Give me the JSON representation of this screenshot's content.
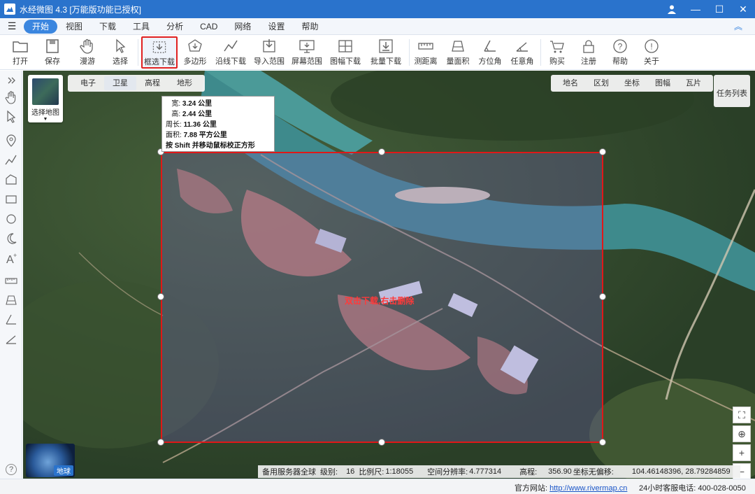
{
  "window": {
    "title": "水经微图 4.3 [万能版功能已授权]"
  },
  "menu": {
    "tabs": [
      "开始",
      "视图",
      "下载",
      "工具",
      "分析",
      "CAD",
      "网络",
      "设置",
      "帮助"
    ]
  },
  "toolbar": {
    "open": "打开",
    "save": "保存",
    "roam": "漫游",
    "select": "选择",
    "box_download": "框选下载",
    "polygon": "多边形",
    "line_download": "沿线下载",
    "import_range": "导入范围",
    "screen_range": "屏幕范围",
    "sheet_download": "图幅下载",
    "batch_download": "批量下载",
    "measure_distance": "测距离",
    "measure_area": "量面积",
    "bearing": "方位角",
    "any_angle": "任意角",
    "buy": "购买",
    "register": "注册",
    "help": "帮助",
    "about": "关于"
  },
  "map": {
    "layer_switch_label": "选择地图",
    "map_types": [
      "电子",
      "卫星",
      "高程",
      "地形"
    ],
    "active_type": "卫星",
    "overlays": [
      "地名",
      "区划",
      "坐标",
      "图幅",
      "瓦片"
    ],
    "task_list": "任务列表",
    "selection_hint": "双击下载,右击删除",
    "info": {
      "width_label": "宽:",
      "width_value": "3.24 公里",
      "height_label": "高:",
      "height_value": "2.44 公里",
      "perimeter_label": "周长:",
      "perimeter_value": "11.36 公里",
      "area_label": "面积:",
      "area_value": "7.88 平方公里",
      "tip": "按 Shift 并移动鼠标校正方形"
    },
    "globe_label": "地球",
    "status": {
      "server": "备用服务器全球",
      "level_label": "级别:",
      "level_value": "16",
      "scale_label": "比例尺:",
      "scale_value": "1:18055",
      "resolution_label": "空间分辨率:",
      "resolution_value": "4.777314",
      "elevation_label": "高程:",
      "elevation_value": "356.90",
      "coord_label": "坐标无偏移:",
      "coord_value": "104.46148396, 28.79284859"
    }
  },
  "statusbar": {
    "site_label": "官方网站:",
    "site_url": "http://www.rivermap.cn",
    "phone_label": "24小时客服电话:",
    "phone_value": "400-028-0050"
  },
  "colors": {
    "accent": "#2a73cc",
    "selection": "#e01818"
  }
}
